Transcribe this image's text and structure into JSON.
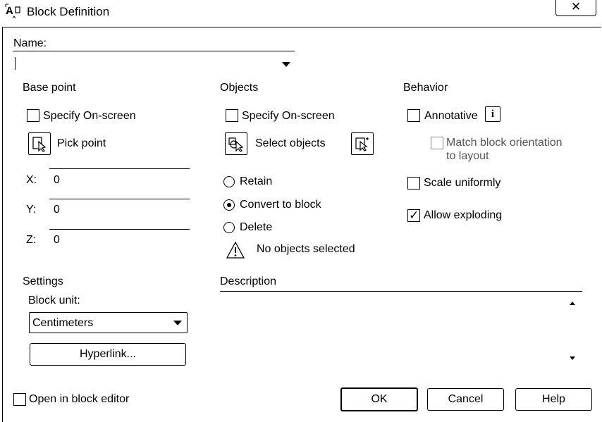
{
  "window": {
    "title": "Block Definition",
    "close_glyph": "✕"
  },
  "name": {
    "label": "Name:",
    "value": ""
  },
  "base_point": {
    "heading": "Base point",
    "specify_on_screen": {
      "label": "Specify On-screen",
      "checked": false
    },
    "pick_point_label": "Pick point",
    "x": {
      "label": "X:",
      "value": "0"
    },
    "y": {
      "label": "Y:",
      "value": "0"
    },
    "z": {
      "label": "Z:",
      "value": "0"
    }
  },
  "objects": {
    "heading": "Objects",
    "specify_on_screen": {
      "label": "Specify On-screen",
      "checked": false
    },
    "select_objects_label": "Select objects",
    "retain_label": "Retain",
    "convert_label": "Convert to block",
    "delete_label": "Delete",
    "selected_option": "Convert to block",
    "status_text": "No objects selected"
  },
  "behavior": {
    "heading": "Behavior",
    "annotative": {
      "label": "Annotative",
      "checked": false
    },
    "match_orientation": {
      "label_line1": "Match block orientation",
      "label_line2": "to layout",
      "checked": false,
      "enabled": false
    },
    "scale_uniformly": {
      "label": "Scale uniformly",
      "checked": false
    },
    "allow_exploding": {
      "label": "Allow exploding",
      "checked": true
    }
  },
  "settings": {
    "heading": "Settings",
    "block_unit_label": "Block unit:",
    "block_unit_value": "Centimeters",
    "hyperlink_label": "Hyperlink..."
  },
  "description": {
    "heading": "Description",
    "value": ""
  },
  "footer": {
    "open_in_editor": {
      "label": "Open in block editor",
      "checked": false
    },
    "ok_label": "OK",
    "cancel_label": "Cancel",
    "help_label": "Help"
  },
  "icons": {
    "app": "block-definition-icon",
    "pick_point": "pick-point-icon",
    "select_objects": "select-objects-icon",
    "quick_select": "quick-select-icon",
    "info": "info-icon",
    "warning": "warning-icon"
  }
}
